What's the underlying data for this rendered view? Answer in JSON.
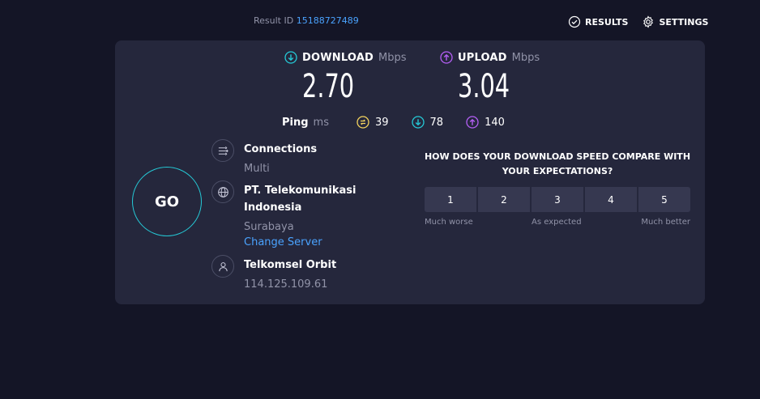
{
  "header": {
    "result_label": "Result ID",
    "result_id": "15188727489",
    "nav": [
      {
        "label": "RESULTS",
        "icon": "check-circle-icon"
      },
      {
        "label": "SETTINGS",
        "icon": "gear-icon"
      }
    ]
  },
  "metrics": {
    "download": {
      "label": "DOWNLOAD",
      "unit": "Mbps",
      "value": "2.70",
      "icon": "download-arrow-icon",
      "color": "#25c9d6"
    },
    "upload": {
      "label": "UPLOAD",
      "unit": "Mbps",
      "value": "3.04",
      "icon": "upload-arrow-icon",
      "color": "#b45ff5"
    }
  },
  "ping": {
    "label": "Ping",
    "unit": "ms",
    "idle": "39",
    "download": "78",
    "upload": "140",
    "colors": {
      "idle": "#f4d35e",
      "download": "#25c9d6",
      "upload": "#b45ff5"
    }
  },
  "go_button": {
    "label": "GO"
  },
  "connections": {
    "title": "Connections",
    "value": "Multi",
    "icon": "connections-icon"
  },
  "server": {
    "name_line1": "PT. Telekomunikasi",
    "name_line2": "Indonesia",
    "location": "Surabaya",
    "change_label": "Change Server",
    "icon": "globe-icon"
  },
  "provider": {
    "name": "Telkomsel Orbit",
    "ip": "114.125.109.61",
    "icon": "user-icon"
  },
  "survey": {
    "question_line1": "HOW DOES YOUR DOWNLOAD SPEED COMPARE WITH",
    "question_line2": "YOUR EXPECTATIONS?",
    "options": [
      "1",
      "2",
      "3",
      "4",
      "5"
    ],
    "label_low": "Much worse",
    "label_mid": "As expected",
    "label_high": "Much better"
  }
}
